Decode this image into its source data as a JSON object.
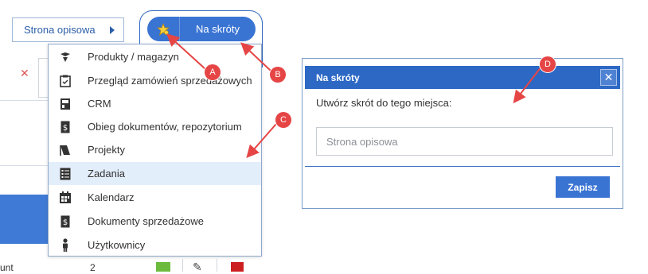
{
  "strona_button": {
    "label": "Strona opisowa"
  },
  "shortcuts_tab": {
    "label": "Na skróty"
  },
  "menu": {
    "items": [
      {
        "label": "Produkty / magazyn",
        "icon": "products-icon",
        "active": false
      },
      {
        "label": "Przegląd zamówień sprzedażowych",
        "icon": "clipboard-icon",
        "active": false
      },
      {
        "label": "CRM",
        "icon": "crm-icon",
        "active": false
      },
      {
        "label": "Obieg dokumentów, repozytorium",
        "icon": "document-flow-icon",
        "active": false
      },
      {
        "label": "Projekty",
        "icon": "projects-icon",
        "active": false
      },
      {
        "label": "Zadania",
        "icon": "tasks-icon",
        "active": true
      },
      {
        "label": "Kalendarz",
        "icon": "calendar-icon",
        "active": false
      },
      {
        "label": "Dokumenty sprzedażowe",
        "icon": "sales-docs-icon",
        "active": false
      },
      {
        "label": "Użytkownicy",
        "icon": "user-icon",
        "active": false
      }
    ]
  },
  "dialog": {
    "title": "Na skróty",
    "prompt": "Utwórz skrót do tego miejsca:",
    "input_placeholder": "Strona opisowa",
    "input_value": "",
    "save_label": "Zapisz"
  },
  "annotations": [
    {
      "letter": "A"
    },
    {
      "letter": "B"
    },
    {
      "letter": "C"
    },
    {
      "letter": "D"
    }
  ],
  "background": {
    "row_text": "unt",
    "row_number": "2"
  },
  "colors": {
    "accent_blue": "#3a74d3",
    "dialog_header": "#2c68c4",
    "annotation_red": "#e64545",
    "active_menu_bg": "#e3eefb"
  }
}
